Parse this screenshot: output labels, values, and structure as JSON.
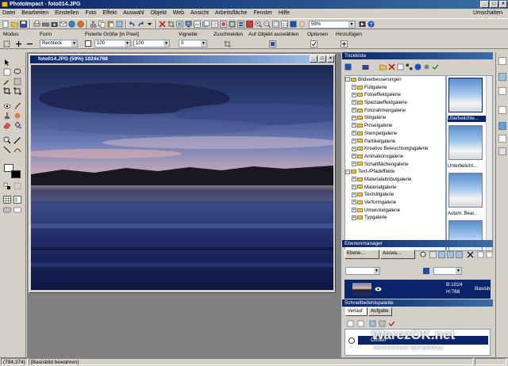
{
  "app": {
    "title": "PhotoImpact - foto014.JPG"
  },
  "menu": {
    "items": [
      "Datei",
      "Bearbeiten",
      "Einstellen",
      "Foto",
      "Effekt",
      "Auswahl",
      "Objekt",
      "Web",
      "Ansicht",
      "Arbeitsfläche",
      "Fenster",
      "Hilfe"
    ],
    "right_item": "Umschalten"
  },
  "toolbar": {
    "zoom": "59%"
  },
  "attributes": {
    "modus_label": "Modus",
    "form_label": "Form",
    "form_value": "Rechteck",
    "fixed_size_label": "Fixierte Größe [in Pixel]",
    "width_value": "100",
    "height_value": "100",
    "vignette_label": "Vignette",
    "vignette_value": "0",
    "crop_label": "Zuschneiden",
    "select_object_label": "Auf Objekt auswählen",
    "options_label": "Optionen",
    "add_label": "Hinzufügen"
  },
  "image_window": {
    "title": "foto014.JPG (59%) 1024x768"
  },
  "trickkiste": {
    "title": "Trickkiste",
    "tree": [
      {
        "label": "Bildverbesserungen",
        "level": 0,
        "expander": "−"
      },
      {
        "label": "Füllgalerie",
        "level": 1,
        "expander": "+"
      },
      {
        "label": "Fotoeffektgalerie",
        "level": 1,
        "expander": "+"
      },
      {
        "label": "Spezialeffektgalerie",
        "level": 1,
        "expander": "+"
      },
      {
        "label": "Fotorahmengalerie",
        "level": 1,
        "expander": "+"
      },
      {
        "label": "Stilgalerie",
        "level": 1,
        "expander": "+"
      },
      {
        "label": "Pinselgalerie",
        "level": 1,
        "expander": "+"
      },
      {
        "label": "Stempelgalerie",
        "level": 1,
        "expander": "+"
      },
      {
        "label": "Partikelgalerie",
        "level": 1,
        "expander": "+"
      },
      {
        "label": "Kreative Beleuchtungsgalerie",
        "level": 1,
        "expander": "+"
      },
      {
        "label": "Animationsgalerie",
        "level": 1,
        "expander": "+"
      },
      {
        "label": "Schaltflächengalerie",
        "level": 1,
        "expander": "+"
      },
      {
        "label": "Text-/Pfadeffekte",
        "level": 0,
        "expander": "−"
      },
      {
        "label": "Materialattributgalerie",
        "level": 1,
        "expander": "+"
      },
      {
        "label": "Materialgalerie",
        "level": 1,
        "expander": "+"
      },
      {
        "label": "Textstilgalerie",
        "level": 1,
        "expander": "+"
      },
      {
        "label": "Verformgalerie",
        "level": 1,
        "expander": "+"
      },
      {
        "label": "Umwickelgalerie",
        "level": 1,
        "expander": "+"
      },
      {
        "label": "Typgalerie",
        "level": 1,
        "expander": "+"
      }
    ],
    "thumbnails": [
      {
        "label": "Überbelichte..."
      },
      {
        "label": "Unterbelicht..."
      },
      {
        "label": "Autom. Bear..."
      }
    ]
  },
  "layer_manager": {
    "title": "Ebenenmanager",
    "tab1": "Ebene...",
    "tab2": "Auswa...",
    "layer_b": "B:1024",
    "layer_h": "H:768",
    "layer_name": "Basisb"
  },
  "quick_command": {
    "title": "Schnellbefehlspalette",
    "tab_history": "Verlauf",
    "tab_task": "Aufgabe",
    "step_label": "Öffnen"
  },
  "watermark": {
    "line1": "WarezOK.net",
    "line2": "бесплатные программы"
  },
  "status": {
    "coords": "(794,374)",
    "message": "[Basisbild bewahren]"
  },
  "colors": {
    "title_start": "#0a246a",
    "title_end": "#3a6ea5",
    "face": "#d4d0c8",
    "workspace": "#808080"
  }
}
